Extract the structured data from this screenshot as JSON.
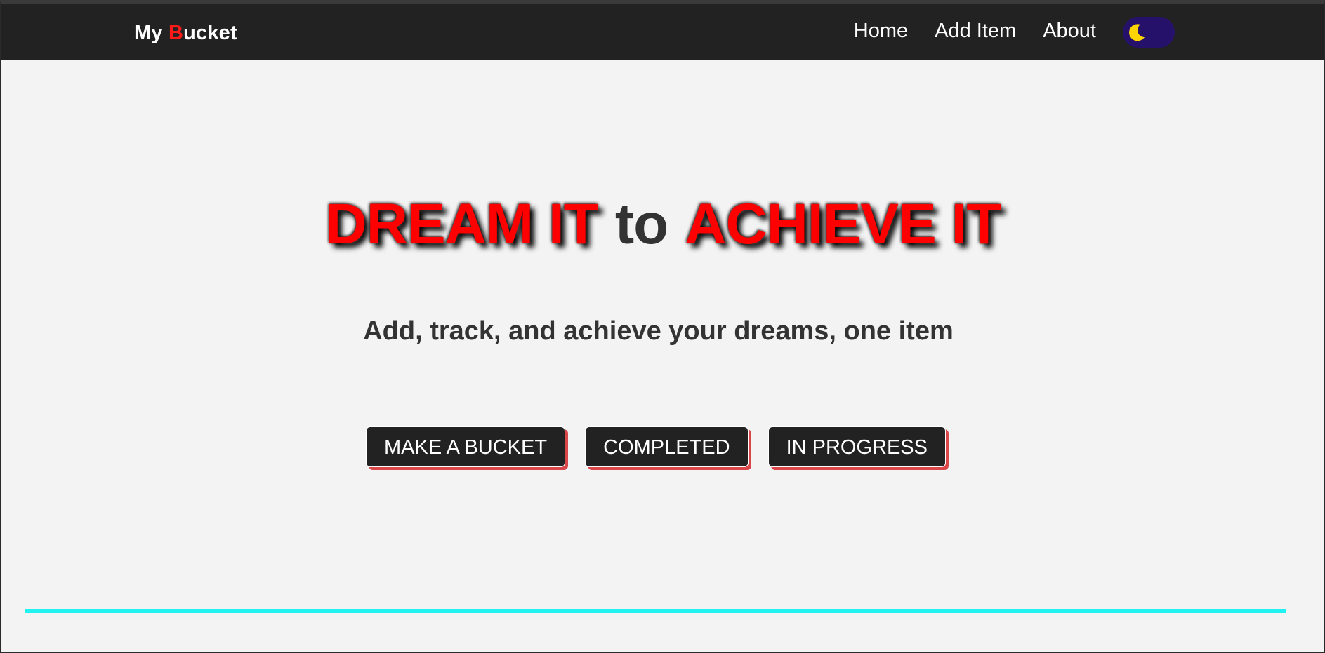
{
  "navbar": {
    "brand_prefix": "My ",
    "brand_accent": "B",
    "brand_suffix": "ucket",
    "links": [
      {
        "label": "Home"
      },
      {
        "label": "Add Item"
      },
      {
        "label": "About"
      }
    ],
    "theme_toggle": {
      "icon": "moon-icon",
      "state": "dark"
    }
  },
  "hero": {
    "title_part1": "DREAM IT",
    "title_part2": "to",
    "title_part3": "ACHIEVE IT",
    "tagline": "Add, track, and achieve your dreams, one item"
  },
  "actions": {
    "make_bucket": "MAKE A BUCKET",
    "completed": "COMPLETED",
    "in_progress": "IN PROGRESS"
  },
  "colors": {
    "navbar_bg": "#222222",
    "accent_red": "#ff0000",
    "toggle_bg": "#26116a",
    "moon": "#ffd400",
    "button_shadow": "#d9474b",
    "divider": "#1ff2f0",
    "page_bg": "#f3f3f3"
  }
}
